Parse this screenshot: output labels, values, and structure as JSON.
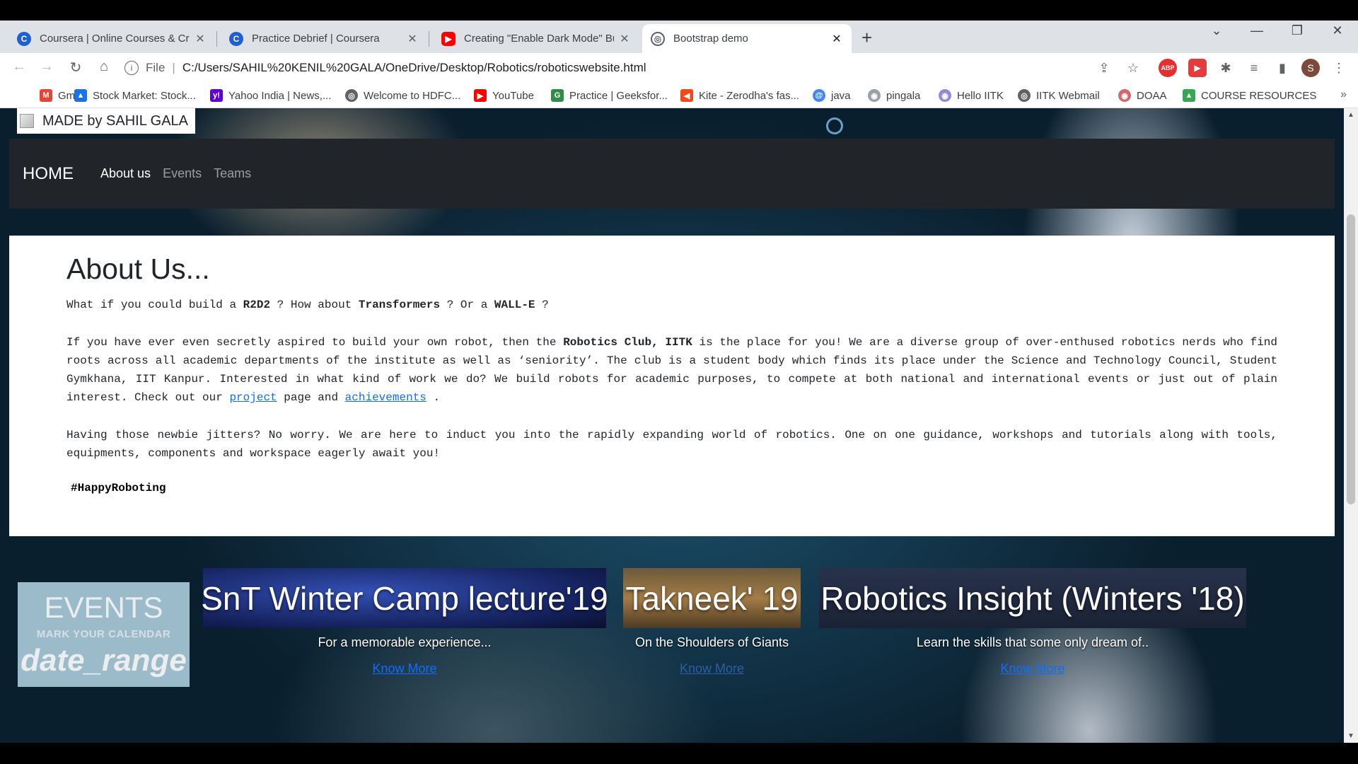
{
  "browser": {
    "tabs": [
      {
        "title": "Coursera | Online Courses & Credentials",
        "favicon": "coursera-icon",
        "active": false
      },
      {
        "title": "Practice Debrief | Coursera",
        "favicon": "coursera-icon",
        "active": false
      },
      {
        "title": "Creating \"Enable Dark Mode\" Button",
        "favicon": "youtube-icon",
        "active": false
      },
      {
        "title": "Bootstrap demo",
        "favicon": "globe-icon",
        "active": true
      }
    ],
    "address": {
      "scheme_label": "File",
      "url": "C:/Users/SAHIL%20KENIL%20GALA/OneDrive/Desktop/Robotics/roboticswebsite.html"
    },
    "profile_initial": "S",
    "bookmarks": [
      {
        "label": "Gmail",
        "icon": "gmail-icon",
        "color": "#ea4335"
      },
      {
        "label": "Stock Market: Stock...",
        "icon": "chart-icon",
        "color": "#1a73e8"
      },
      {
        "label": "Yahoo India | News,...",
        "icon": "yahoo-icon",
        "color": "#6001d2"
      },
      {
        "label": "Welcome to HDFC...",
        "icon": "globe-icon",
        "color": "#5f6368"
      },
      {
        "label": "YouTube",
        "icon": "youtube-icon",
        "color": "#ff0000"
      },
      {
        "label": "Practice | Geeksfor...",
        "icon": "geeksforgeeks-icon",
        "color": "#2f8d46"
      },
      {
        "label": "Kite - Zerodha's fas...",
        "icon": "kite-icon",
        "color": "#f6461a"
      },
      {
        "label": "java",
        "icon": "swirl-icon",
        "color": "#4285f4"
      },
      {
        "label": "pingala",
        "icon": "circle-icon",
        "color": "#9aa0a6"
      },
      {
        "label": "Hello IITK",
        "icon": "circle-icon",
        "color": "#8e8cd8"
      },
      {
        "label": "IITK Webmail",
        "icon": "globe-icon",
        "color": "#5f6368"
      },
      {
        "label": "DOAA",
        "icon": "circle-icon",
        "color": "#d4696b"
      },
      {
        "label": "COURSE RESOURCES",
        "icon": "google-drive-icon",
        "color": "#34a853"
      }
    ]
  },
  "page": {
    "brand_tag": "MADE by SAHIL GALA",
    "nav": {
      "brand": "HOME",
      "links": [
        "About us",
        "Events",
        "Teams"
      ]
    },
    "about": {
      "heading": "About Us...",
      "q1_a": "What if you could build a ",
      "q1_r2d2": "R2D2",
      "q1_b": " ? How about ",
      "q1_transformers": "Transformers",
      "q1_c": " ? Or a ",
      "q1_walle": "WALL-E",
      "q1_d": " ?",
      "p2_a": "If you have ever even secretly aspired to build your own robot, then the ",
      "p2_club": "Robotics Club, IITK",
      "p2_b": " is the place for you! We are a diverse group of over-enthused robotics nerds who find roots across all academic departments of the institute as well as ‘seniority’. The club is a student body which finds its place under the Science and Technology Council, Student Gymkhana, IIT Kanpur. Interested in what kind of work we do? We build robots for academic purposes, to compete at both national and international events or just out of plain interest. Check out our ",
      "p2_project": "project",
      "p2_c": " page and ",
      "p2_achievements": "achievements",
      "p2_d": " .",
      "p3": "Having those newbie jitters? No worry. We are here to induct you into the rapidly expanding world of robotics. One on one guidance, workshops and tutorials along with tools, equipments, components and workspace eagerly await you!",
      "tag": "#HappyRoboting"
    },
    "events": {
      "title": "EVENTS",
      "subtitle": "MARK YOUR CALENDAR",
      "icon_text": "date_range",
      "cards": [
        {
          "title": "SnT Winter Camp lecture'19",
          "text": "For a memorable experience...",
          "link": "Know More"
        },
        {
          "title": "Takneek' 19",
          "text": "On the Shoulders of Giants",
          "link": "Know More"
        },
        {
          "title": "Robotics Insight (Winters '18)",
          "text": "Learn the skills that some only dream of..",
          "link": "Know More"
        }
      ]
    }
  }
}
